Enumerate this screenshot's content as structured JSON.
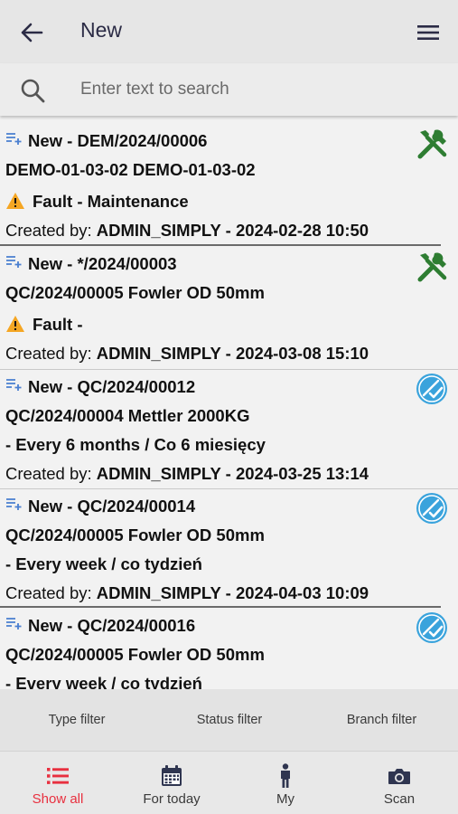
{
  "header": {
    "title": "New"
  },
  "search": {
    "placeholder": "Enter text to search"
  },
  "items": [
    {
      "title": "New - DEM/2024/00006",
      "subtitle": "DEMO-01-03-02 DEMO-01-03-02",
      "detail": "Fault - Maintenance",
      "created_prefix": "Created by: ",
      "created_value": "ADMIN_SIMPLY - 2024-02-28 10:50",
      "status_icon": "tools-icon",
      "has_warning": true
    },
    {
      "title": "New - */2024/00003",
      "subtitle": "QC/2024/00005 Fowler OD 50mm",
      "detail": "Fault -",
      "created_prefix": "Created by: ",
      "created_value": "ADMIN_SIMPLY - 2024-03-08 15:10",
      "status_icon": "tools-icon",
      "has_warning": true
    },
    {
      "title": "New - QC/2024/00012",
      "subtitle": "QC/2024/00004 Mettler 2000KG",
      "detail": "- Every 6 months / Co 6 miesięcy",
      "created_prefix": "Created by: ",
      "created_value": "ADMIN_SIMPLY - 2024-03-25 13:14",
      "status_icon": "inspection-check-icon",
      "has_warning": false
    },
    {
      "title": "New - QC/2024/00014",
      "subtitle": "QC/2024/00005 Fowler OD 50mm",
      "detail": "- Every week / co tydzień",
      "created_prefix": "Created by: ",
      "created_value": "ADMIN_SIMPLY - 2024-04-03 10:09",
      "status_icon": "inspection-check-icon",
      "has_warning": false
    },
    {
      "title": "New - QC/2024/00016",
      "subtitle": "QC/2024/00005 Fowler OD 50mm",
      "detail": "- Every week / co tydzień",
      "status_icon": "inspection-check-icon",
      "has_warning": false
    }
  ],
  "filters": {
    "type": "Type filter",
    "status": "Status filter",
    "branch": "Branch filter"
  },
  "nav": {
    "show_all": "Show all",
    "for_today": "For today",
    "my": "My",
    "scan": "Scan"
  },
  "colors": {
    "accent": "#e8303f",
    "tools": "#2e7d32",
    "check": "#3aa3dc",
    "warning": "#f5a623"
  }
}
